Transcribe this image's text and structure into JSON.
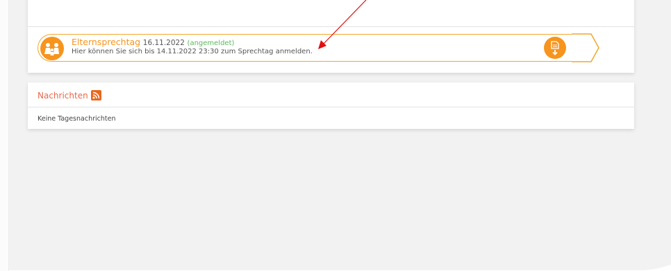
{
  "event": {
    "name": "Elternsprechtag",
    "date": "16.11.2022",
    "status": "(angemeldet)",
    "description": "Hier können Sie sich bis 14.11.2022 23:30 zum Sprechtag anmelden.",
    "left_icon": "parents-icon",
    "right_icon": "document-download-icon"
  },
  "news": {
    "title": "Nachrichten",
    "feed_icon": "rss-icon",
    "empty_text": "Keine Tagesnachrichten"
  },
  "colors": {
    "accent": "#f7941d",
    "status_green": "#5cb85c",
    "news_title": "#e8674a",
    "annotation_arrow": "#e01010"
  }
}
